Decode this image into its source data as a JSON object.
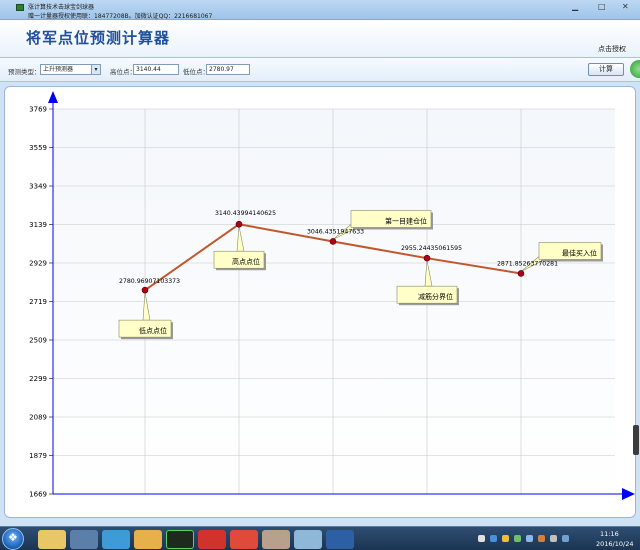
{
  "window": {
    "title": "涨计算技术击球宝剑球器",
    "subtitle": "赠一计量器授权使用联：18477208B。加微认证QQ：2216681067"
  },
  "header": {
    "app_title": "将军点位预测计算器",
    "auth_link": "点击授权"
  },
  "toolbar": {
    "predict_type_label": "预测类型：",
    "predict_type_value": "上升预测器",
    "high_label": "高位点：",
    "high_value": "3140.44",
    "low_label": "低位点：",
    "low_value": "2780.97",
    "calc_button": "计算"
  },
  "colors": {
    "axis": "#0000ff",
    "series_line": "#c0572f",
    "marker": "#b00015",
    "grid": "#c8c8c8",
    "callout_fill": "#ffffc8"
  },
  "chart_data": {
    "type": "line",
    "x_labels": [],
    "y_ticks": [
      1669,
      1879,
      2089,
      2299,
      2509,
      2719,
      2929,
      3139,
      3349,
      3559,
      3769
    ],
    "ylim": [
      1669,
      3769
    ],
    "grid": true,
    "series": [
      {
        "points": [
          {
            "x": 1,
            "y": 2780.96907,
            "label": "2780.96907103373",
            "callout": "低点点位"
          },
          {
            "x": 2,
            "y": 3140.43994,
            "label": "3140.43994140625",
            "callout": "高点点位"
          },
          {
            "x": 3,
            "y": 3046.43519,
            "label": "3046.4351947633",
            "callout": "第一目建仓位"
          },
          {
            "x": 4,
            "y": 2955.24436,
            "label": "2955.24435061595",
            "callout": "减筋分界位"
          },
          {
            "x": 5,
            "y": 2871.85264,
            "label": "2871.85263770281",
            "callout": "最佳买入位"
          }
        ]
      }
    ]
  },
  "taskbar": {
    "clock_time": "11:16",
    "clock_date": "2016/10/24",
    "icons": [
      "start-icon",
      "file-explorer-icon",
      "window-switch-icon",
      "ie-icon",
      "folder-icon",
      "stock-chart-icon",
      "pdf-icon",
      "media-icon",
      "app-icon",
      "notes-icon",
      "cube-icon",
      "terminal-icon"
    ]
  }
}
